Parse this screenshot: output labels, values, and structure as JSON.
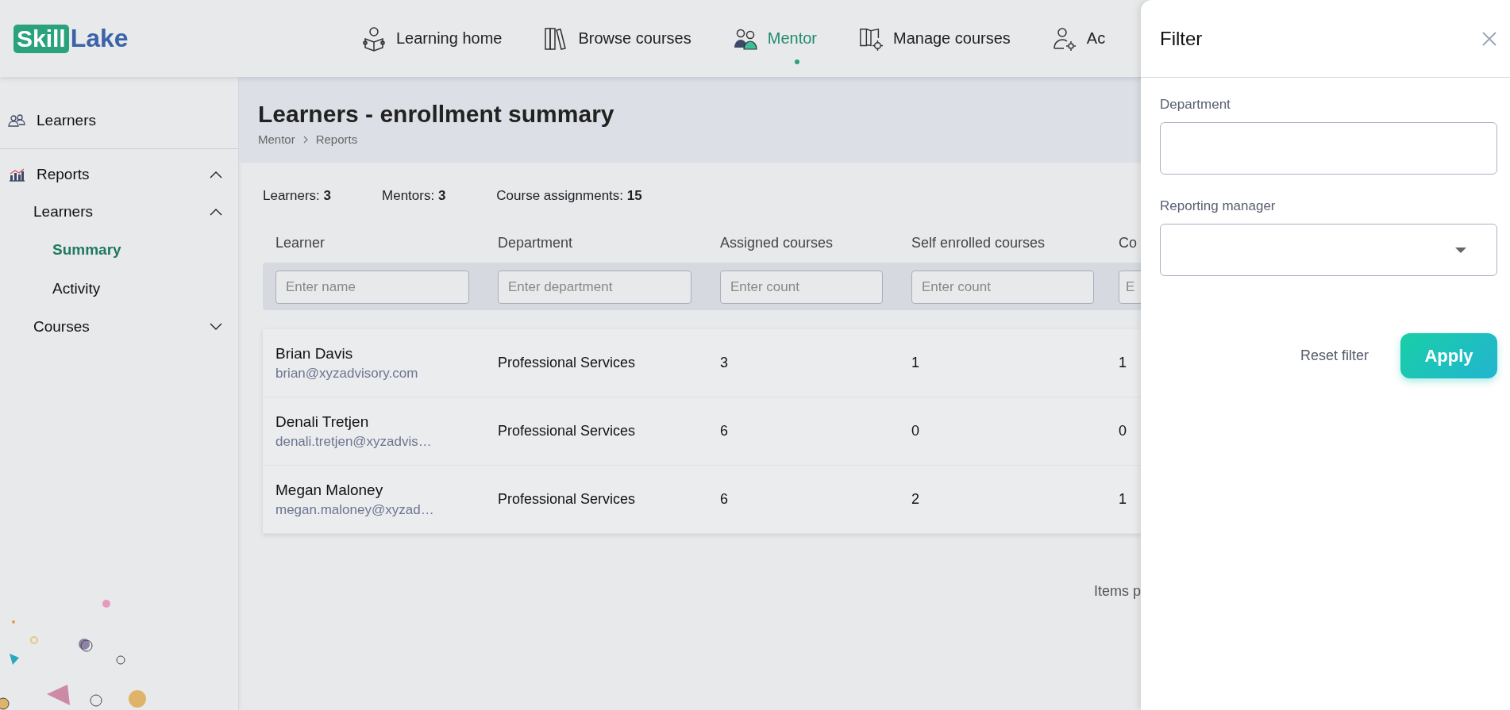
{
  "logo": {
    "badge": "Skill",
    "text": "Lake"
  },
  "nav": [
    {
      "label": "Learning home",
      "selected": false
    },
    {
      "label": "Browse courses",
      "selected": false
    },
    {
      "label": "Mentor",
      "selected": true
    },
    {
      "label": "Manage courses",
      "selected": false
    },
    {
      "label": "Ac",
      "selected": false
    }
  ],
  "sidebar": {
    "items": [
      {
        "label": "Learners",
        "selected": false
      },
      {
        "label": "Reports",
        "selected": false,
        "expanded": true,
        "children": [
          {
            "label": "Learners",
            "selected": false,
            "expanded": true,
            "children": [
              {
                "label": "Summary",
                "selected": true
              },
              {
                "label": "Activity",
                "selected": false
              }
            ]
          },
          {
            "label": "Courses",
            "selected": false,
            "expanded": false
          }
        ]
      }
    ]
  },
  "page": {
    "title": "Learners - enrollment summary",
    "breadcrumb": [
      "Mentor",
      "Reports"
    ]
  },
  "stats": [
    {
      "label": "Learners:",
      "value": "3"
    },
    {
      "label": "Mentors:",
      "value": "3"
    },
    {
      "label": "Course assignments:",
      "value": "15"
    }
  ],
  "table": {
    "columns": [
      {
        "header": "Learner",
        "placeholder": "Enter name"
      },
      {
        "header": "Department",
        "placeholder": "Enter department"
      },
      {
        "header": "Assigned courses",
        "placeholder": "Enter count"
      },
      {
        "header": "Self enrolled courses",
        "placeholder": "Enter count"
      },
      {
        "header": "Co",
        "placeholder": "E"
      }
    ],
    "rows": [
      {
        "name": "Brian Davis",
        "email": "brian@xyzadvisory.com",
        "department": "Professional Services",
        "assigned": "3",
        "self_enrolled": "1",
        "column_5": "1"
      },
      {
        "name": "Denali Tretjen",
        "email": "denali.tretjen@xyzadvis…",
        "department": "Professional Services",
        "assigned": "6",
        "self_enrolled": "0",
        "column_5": "0"
      },
      {
        "name": "Megan Maloney",
        "email": "megan.maloney@xyzad…",
        "department": "Professional Services",
        "assigned": "6",
        "self_enrolled": "2",
        "column_5": "1"
      }
    ]
  },
  "pagination": {
    "label": "Items p"
  },
  "filter_panel": {
    "title": "Filter",
    "fields": [
      {
        "kind": "text",
        "label": "Department"
      },
      {
        "kind": "select",
        "label": "Reporting manager"
      }
    ],
    "reset": "Reset filter",
    "apply": "Apply"
  }
}
